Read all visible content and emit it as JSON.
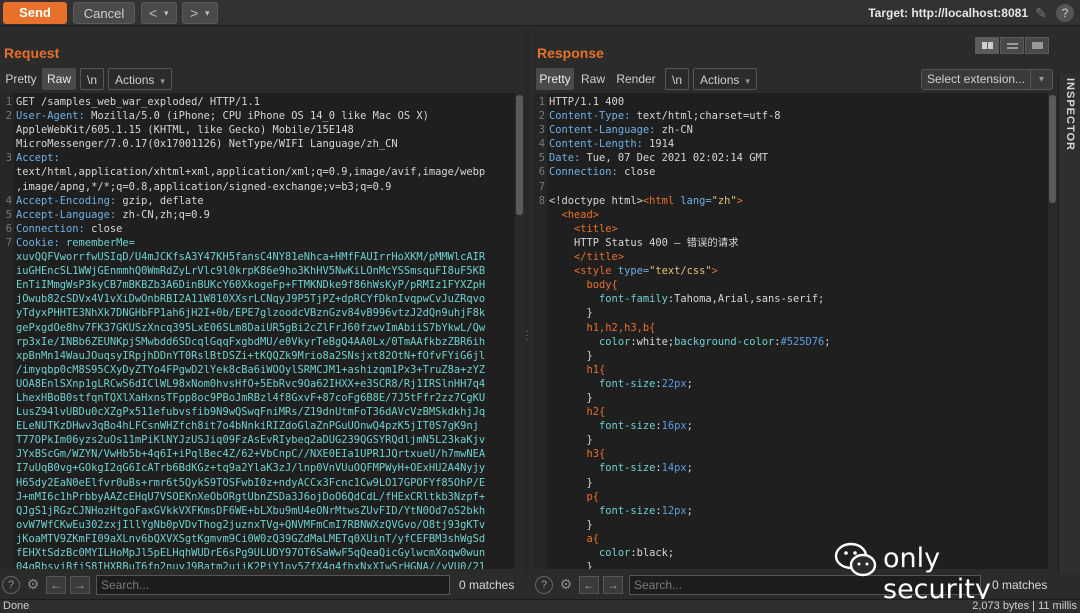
{
  "toolbar": {
    "send": "Send",
    "cancel": "Cancel",
    "back": "<",
    "fwd": ">",
    "target_label": "Target: http://localhost:8081",
    "help": "?"
  },
  "request": {
    "title": "Request",
    "tabs": [
      "Pretty",
      "Raw",
      "\\n",
      "Actions"
    ],
    "selected_tab": "Raw",
    "lines": [
      {
        "n": "1",
        "segs": [
          [
            "",
            "GET /samples_web_war_exploded/ HTTP/1.1"
          ]
        ]
      },
      {
        "n": "2",
        "segs": [
          [
            "k",
            "User-Agent: "
          ],
          [
            "",
            "Mozilla/5.0 (iPhone; CPU iPhone OS 14_0 like Mac OS X)"
          ]
        ]
      },
      {
        "n": "",
        "segs": [
          [
            "",
            "AppleWebKit/605.1.15 (KHTML, like Gecko) Mobile/15E148"
          ]
        ]
      },
      {
        "n": "",
        "segs": [
          [
            "",
            "MicroMessenger/7.0.17(0x17001126) NetType/WIFI Language/zh_CN"
          ]
        ]
      },
      {
        "n": "3",
        "segs": [
          [
            "k",
            "Accept:"
          ]
        ]
      },
      {
        "n": "",
        "segs": [
          [
            "",
            "text/html,application/xhtml+xml,application/xml;q=0.9,image/avif,image/webp"
          ]
        ]
      },
      {
        "n": "",
        "segs": [
          [
            "",
            ",image/apng,*/*;q=0.8,application/signed-exchange;v=b3;q=0.9"
          ]
        ]
      },
      {
        "n": "4",
        "segs": [
          [
            "k",
            "Accept-Encoding: "
          ],
          [
            "",
            "gzip, deflate"
          ]
        ]
      },
      {
        "n": "5",
        "segs": [
          [
            "k",
            "Accept-Language: "
          ],
          [
            "",
            "zh-CN,zh;q=0.9"
          ]
        ]
      },
      {
        "n": "6",
        "segs": [
          [
            "k",
            "Connection: "
          ],
          [
            "",
            "close"
          ]
        ]
      },
      {
        "n": "7",
        "segs": [
          [
            "k",
            "Cookie: "
          ],
          [
            "ck",
            "rememberMe="
          ]
        ]
      },
      {
        "n": "",
        "segs": [
          [
            "ck",
            "xuvQQFVworrfwUSIqD/U4mJCKfsA3Y47KH5fansC4NY81eNhca+HMfFAUIrrHoXKM/pMMWlcAIR"
          ]
        ]
      },
      {
        "n": "",
        "segs": [
          [
            "ck",
            "iuGHEncSL1WWjGEnmmhQ0WmRdZyLrVlc9l0krpK86e9ho3KhHV5NwKiLOnMcYSSmsquFI8uF5KB"
          ]
        ]
      },
      {
        "n": "",
        "segs": [
          [
            "ck",
            "EnTiIMmgWsP3kyCB7mBKBZb3A6DinBUKcY60XkogeFp+FTMKNDke9f86hWsKyP/pRMIz1FYXZpH"
          ]
        ]
      },
      {
        "n": "",
        "segs": [
          [
            "ck",
            "jOwub82cSDVx4V1vXiDwOnbRBI2A11W810XXsrLCNqyJ9P5TjPZ+dpRCYfDknIvqpwCvJuZRqvo"
          ]
        ]
      },
      {
        "n": "",
        "segs": [
          [
            "ck",
            "yTdyxPHHTE3NhXk7DNGHbFP1ah6jH2I+0b/EPE7glzoodcVBznGzv84vB996vtzJ2dQn9uhjF8k"
          ]
        ]
      },
      {
        "n": "",
        "segs": [
          [
            "ck",
            "gePxgdOe8hv7FK37GKUSzXncq395LxE06SLm8DaiUR5gBi2cZlFrJ60fzwvImAbiiS7bYkwL/Qw"
          ]
        ]
      },
      {
        "n": "",
        "segs": [
          [
            "ck",
            "rp3xIe/INBb6ZEUNKpjSMwbdd6SDcqlGqqFxgbdMU/e0VkyrTeBgQ4AA0Lx/0TmAAfkbzZBR6ih"
          ]
        ]
      },
      {
        "n": "",
        "segs": [
          [
            "ck",
            "xpBnMn14WauJOuqsyIRpjhDDnYT0RslBtDSZi+tKQQZk9Mrio8a2SNsjxt82OtN+fOfvFYiG6jl"
          ]
        ]
      },
      {
        "n": "",
        "segs": [
          [
            "ck",
            "/imyqbp0cM8S95CXyDyZTYo4FPgwD2lYek8cBa6iWOOylSRMCJM1+ashizqm1Px3+TruZ8a+zYZ"
          ]
        ]
      },
      {
        "n": "",
        "segs": [
          [
            "ck",
            "UOA8EnlSXnp1gLRCwS6dIClWL98xNom0hvsHfO+5EbRvc9Oa62IHXX+e3SCR8/Rj1IRSlnHH7q4"
          ]
        ]
      },
      {
        "n": "",
        "segs": [
          [
            "ck",
            "LhexHBoB0stfqnTQXlXaHxnsTFpp8oc9PBoJmRBzl4f8GxvF+87coFg6B8E/7J5tFfr2zz7CgKU"
          ]
        ]
      },
      {
        "n": "",
        "segs": [
          [
            "ck",
            "LusZ94lvUBDu0cXZgPx511efubvsfib9N9wQSwqFniMRs/Z19dnUtmFoT36dAVcVzBMSkdkhjJq"
          ]
        ]
      },
      {
        "n": "",
        "segs": [
          [
            "ck",
            "ELeNUTKzDHwv3qBo4hLFCsnWHZfch8it7o4bNnkiRIZdoGlaZnPGuUOnwQ4pzK5jIT0S7gK9nj"
          ]
        ]
      },
      {
        "n": "",
        "segs": [
          [
            "ck",
            "T77OPkIm06yzs2uOs11mPiKlNYJzUSJiq09FzAsEvRIybeq2aDUG239QGSYRQdljmN5L23kaKjv"
          ]
        ]
      },
      {
        "n": "",
        "segs": [
          [
            "ck",
            "JYxBScGm/WZYN/VwHb5b+4q6I+iPqlBec4Z/62+VbCnpC//NXE0EIa1UPR1JQrtxueU/h7mwNEA"
          ]
        ]
      },
      {
        "n": "",
        "segs": [
          [
            "ck",
            "I7uUqB0vg+GOkgI2qG6IcATrb6BdKGz+tq9a2YlaK3zJ/lnp0VnVUuOQFMPWyH+OExHU2A4Nyjy"
          ]
        ]
      },
      {
        "n": "",
        "segs": [
          [
            "ck",
            "H65dy2EaN0eElfvr0uBs+rmr6t5QykS9TOSFwbI0z+ndyACCx3Fcnc1Cw9LO17GPOFYf85OhP/E"
          ]
        ]
      },
      {
        "n": "",
        "segs": [
          [
            "ck",
            "J+mMI6c1hPrbbyAAZcEHqU7VSOEKnXeObORgtUbnZSDa3J6ojDoO6QdCdL/fHExCRltkb3Nzpf+"
          ]
        ]
      },
      {
        "n": "",
        "segs": [
          [
            "ck",
            "QJgS1jRGzCJNHozHtgoFaxGVkkVXFKmsDF6WE+bLXbu9mU4eONrMtwsZUvFID/YtN0Od7oS2bkh"
          ]
        ]
      },
      {
        "n": "",
        "segs": [
          [
            "ck",
            "ovW7WfCKwEu302zxjIllYgNb0pVDvThog2juznxTVg+QNVMFmCmI7RBNWXzQVGvo/O8tj93gKTv"
          ]
        ]
      },
      {
        "n": "",
        "segs": [
          [
            "ck",
            "jKoaMTV9ZKmFI09aXLnv6bQXVXSgtKgmvm9Ci0W0zQ39GZdMaLMETq0XUinT/yfCEFBM3shWgSd"
          ]
        ]
      },
      {
        "n": "",
        "segs": [
          [
            "ck",
            "fEHXtSdzBc0MYILHoMpJl5pELHqhWUDrE6sPg9ULUDY97OT6SaWwF5qQeaQicGylwcmXoqw0wun"
          ]
        ]
      },
      {
        "n": "",
        "segs": [
          [
            "ck",
            "04qRbsvjBfjS8IHXRBuT6fn2nuyJ9Batm2ujiK2PjY1ov5ZfX4q4fhxNxXIwSrHGNA//yVU0/21"
          ]
        ]
      }
    ],
    "search_placeholder": "Search...",
    "matches": "0 matches"
  },
  "response": {
    "title": "Response",
    "tabs": [
      "Pretty",
      "Raw",
      "Render",
      "\\n",
      "Actions"
    ],
    "selected_tab": "Pretty",
    "select_extension": "Select extension...",
    "lines": [
      {
        "n": "1",
        "segs": [
          [
            "",
            "HTTP/1.1 400"
          ]
        ]
      },
      {
        "n": "2",
        "segs": [
          [
            "k",
            "Content-Type: "
          ],
          [
            "",
            "text/html;charset=utf-8"
          ]
        ]
      },
      {
        "n": "3",
        "segs": [
          [
            "k",
            "Content-Language: "
          ],
          [
            "",
            "zh-CN"
          ]
        ]
      },
      {
        "n": "4",
        "segs": [
          [
            "k",
            "Content-Length: "
          ],
          [
            "",
            "1914"
          ]
        ]
      },
      {
        "n": "5",
        "segs": [
          [
            "k",
            "Date: "
          ],
          [
            "",
            "Tue, 07 Dec 2021 02:02:14 GMT"
          ]
        ]
      },
      {
        "n": "6",
        "segs": [
          [
            "k",
            "Connection: "
          ],
          [
            "",
            "close"
          ]
        ]
      },
      {
        "n": "7",
        "segs": [
          [
            "",
            ""
          ]
        ]
      },
      {
        "n": "8",
        "segs": [
          [
            "",
            "<!doctype html>"
          ],
          [
            "t",
            "<html "
          ],
          [
            "an",
            "lang="
          ],
          [
            "av",
            "\"zh\""
          ],
          [
            "t",
            ">"
          ]
        ]
      },
      {
        "n": "",
        "segs": [
          [
            "t",
            "  <head>"
          ]
        ]
      },
      {
        "n": "",
        "segs": [
          [
            "t",
            "    <title>"
          ]
        ]
      },
      {
        "n": "",
        "segs": [
          [
            "",
            "    HTTP Status 400 – 错误的请求"
          ]
        ]
      },
      {
        "n": "",
        "segs": [
          [
            "t",
            "    </title>"
          ]
        ]
      },
      {
        "n": "",
        "segs": [
          [
            "t",
            "    <style "
          ],
          [
            "an",
            "type="
          ],
          [
            "av",
            "\"text/css\""
          ],
          [
            "t",
            ">"
          ]
        ]
      },
      {
        "n": "",
        "segs": [
          [
            "t",
            "      body{"
          ]
        ]
      },
      {
        "n": "",
        "segs": [
          [
            "pr",
            "        font-family"
          ],
          [
            "",
            ":Tahoma,Arial,sans-serif;"
          ]
        ]
      },
      {
        "n": "",
        "segs": [
          [
            "",
            "      }"
          ]
        ]
      },
      {
        "n": "",
        "segs": [
          [
            "t",
            "      h1,h2,h3,b{"
          ]
        ]
      },
      {
        "n": "",
        "segs": [
          [
            "pr",
            "        color"
          ],
          [
            "",
            ":white;"
          ],
          [
            "pr",
            "background-color"
          ],
          [
            "",
            ":"
          ],
          [
            "vblue",
            "#525D76"
          ],
          [
            "",
            ";"
          ]
        ]
      },
      {
        "n": "",
        "segs": [
          [
            "",
            "      }"
          ]
        ]
      },
      {
        "n": "",
        "segs": [
          [
            "t",
            "      h1{"
          ]
        ]
      },
      {
        "n": "",
        "segs": [
          [
            "pr",
            "        font-size"
          ],
          [
            "",
            ":"
          ],
          [
            "vblue",
            "22px"
          ],
          [
            "",
            ";"
          ]
        ]
      },
      {
        "n": "",
        "segs": [
          [
            "",
            "      }"
          ]
        ]
      },
      {
        "n": "",
        "segs": [
          [
            "t",
            "      h2{"
          ]
        ]
      },
      {
        "n": "",
        "segs": [
          [
            "pr",
            "        font-size"
          ],
          [
            "",
            ":"
          ],
          [
            "vblue",
            "16px"
          ],
          [
            "",
            ";"
          ]
        ]
      },
      {
        "n": "",
        "segs": [
          [
            "",
            "      }"
          ]
        ]
      },
      {
        "n": "",
        "segs": [
          [
            "t",
            "      h3{"
          ]
        ]
      },
      {
        "n": "",
        "segs": [
          [
            "pr",
            "        font-size"
          ],
          [
            "",
            ":"
          ],
          [
            "vblue",
            "14px"
          ],
          [
            "",
            ";"
          ]
        ]
      },
      {
        "n": "",
        "segs": [
          [
            "",
            "      }"
          ]
        ]
      },
      {
        "n": "",
        "segs": [
          [
            "t",
            "      p{"
          ]
        ]
      },
      {
        "n": "",
        "segs": [
          [
            "pr",
            "        font-size"
          ],
          [
            "",
            ":"
          ],
          [
            "vblue",
            "12px"
          ],
          [
            "",
            ";"
          ]
        ]
      },
      {
        "n": "",
        "segs": [
          [
            "",
            "      }"
          ]
        ]
      },
      {
        "n": "",
        "segs": [
          [
            "t",
            "      a{"
          ]
        ]
      },
      {
        "n": "",
        "segs": [
          [
            "pr",
            "        color"
          ],
          [
            "",
            ":black;"
          ]
        ]
      },
      {
        "n": "",
        "segs": [
          [
            "",
            "      }"
          ]
        ]
      }
    ],
    "search_placeholder": "Search...",
    "matches": "0 matches"
  },
  "inspector": "INSPECTOR",
  "status": {
    "left": "Done",
    "right": "2,073 bytes | 11 millis"
  },
  "watermark": "only security",
  "colors": {
    "accent": "#e8702a",
    "keyword": "#6fb0e6",
    "cookie": "#6fd0d0",
    "value": "#e3c07a"
  }
}
